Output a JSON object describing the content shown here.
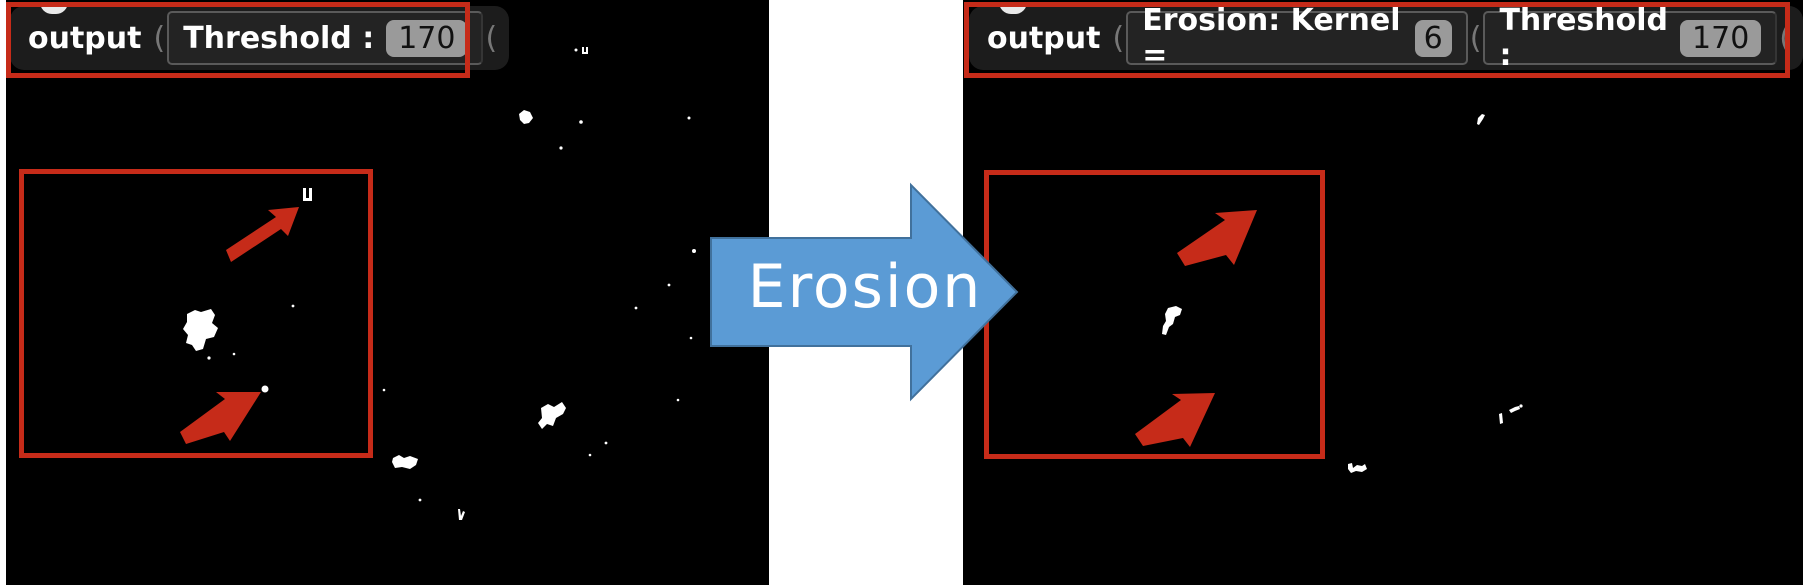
{
  "left_panel": {
    "block": {
      "output_label": "output",
      "threshold_label": "Threshold :",
      "threshold_value": "170"
    }
  },
  "right_panel": {
    "block": {
      "output_label": "output",
      "erosion_label": "Erosion: Kernel =",
      "kernel_value": "6",
      "threshold_label": "Threshold :",
      "threshold_value": "170"
    }
  },
  "arrow": {
    "label": "Erosion",
    "color": "#5b9bd5"
  },
  "colors": {
    "highlight": "#c62b19",
    "background": "#000000",
    "blob": "#ffffff"
  }
}
